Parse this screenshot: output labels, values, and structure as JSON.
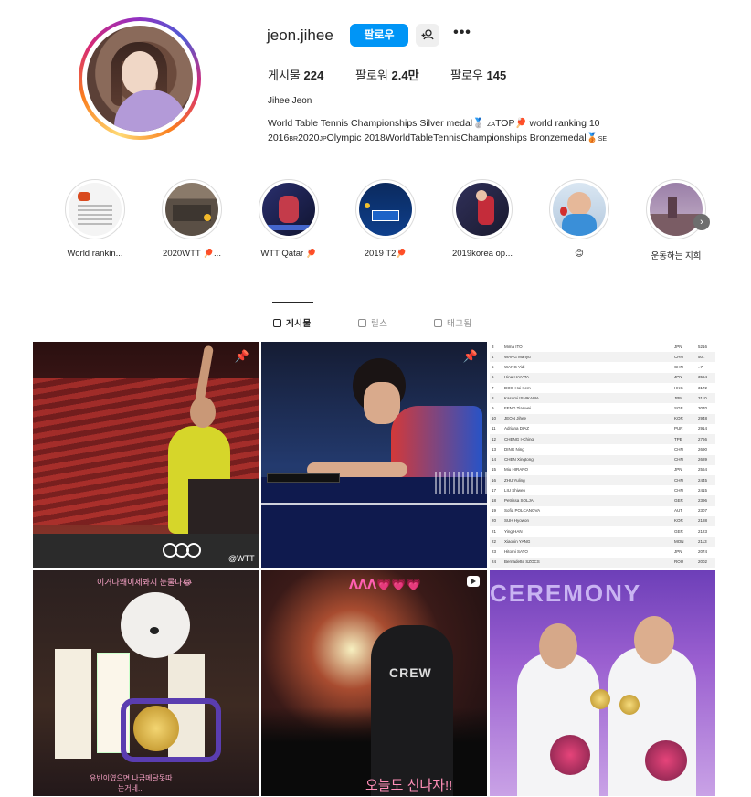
{
  "profile": {
    "username": "jeon.jihee",
    "follow_label": "팔로우",
    "more_label": "•••",
    "posts_label": "게시물",
    "posts_count": "224",
    "followers_label": "팔로워",
    "followers_count": "2.4만",
    "following_label": "팔로우",
    "following_count": "145",
    "full_name": "Jihee Jeon",
    "bio_line1_a": "World Table Tennis Championships Silver medal",
    "bio_line1_flag": "ZA",
    "bio_line1_b": "TOP",
    "bio_line1_c": " world ranking 10",
    "bio_line2_a": "2016",
    "bio_line2_flag1": "BR",
    "bio_line2_b": "2020",
    "bio_line2_flag2": "JP",
    "bio_line2_c": "Olympic 2018WorldTableTennisChampionships Bronzemedal",
    "bio_line2_flag3": "SE"
  },
  "highlights": [
    {
      "label": "World rankin..."
    },
    {
      "label": "2020WTT 🏓..."
    },
    {
      "label": "WTT Qatar 🏓"
    },
    {
      "label": "2019 T2🏓"
    },
    {
      "label": "2019korea op..."
    },
    {
      "label": "😊"
    },
    {
      "label": "운동하는 지희"
    }
  ],
  "tabs": [
    {
      "label": "게시물",
      "active": true
    },
    {
      "label": "릴스",
      "active": false
    },
    {
      "label": "태그됨",
      "active": false
    }
  ],
  "posts": {
    "p1_watermark": "@WTT",
    "p5_banner": "ᐱᐱᐱ💗💗💗",
    "p5_jacket": "CREW",
    "p5_caption": "오늘도 신나자!!",
    "p4_top": "이거나왜이제봐지 눈물나😂",
    "p4_bottom": "유빈이였으면 나금메달못따\n는거네...",
    "p6_banner": "CEREMONY"
  },
  "ranking": [
    [
      "3",
      "Mima ITO",
      "JPN",
      "5216"
    ],
    [
      "4",
      "WANG Manyu",
      "CHN",
      "50.."
    ],
    [
      "5",
      "WANG Yidi",
      "CHN",
      "..7"
    ],
    [
      "6",
      "Hina HAYATA",
      "JPN",
      "3564"
    ],
    [
      "7",
      "DOO Hoi Kem",
      "HKG",
      "3172"
    ],
    [
      "8",
      "Kasumi ISHIKAWA",
      "JPN",
      "3110"
    ],
    [
      "9",
      "FENG Tianwei",
      "SGP",
      "3070"
    ],
    [
      "10",
      "JEON Jihee",
      "KOR",
      "2948"
    ],
    [
      "11",
      "Adriana DIAZ",
      "PUR",
      "2914"
    ],
    [
      "12",
      "CHENG I-Ching",
      "TPE",
      "2766"
    ],
    [
      "13",
      "DING Ning",
      "CHN",
      "2690"
    ],
    [
      "14",
      "CHEN Xingtong",
      "CHN",
      "2689"
    ],
    [
      "15",
      "Miu HIRANO",
      "JPN",
      "2564"
    ],
    [
      "16",
      "ZHU Yuling",
      "CHN",
      "2445"
    ],
    [
      "17",
      "LIU Shiwen",
      "CHN",
      "2415"
    ],
    [
      "18",
      "Petrissa SOLJA",
      "GER",
      "2396"
    ],
    [
      "19",
      "Sofia POLCANOVA",
      "AUT",
      "2307"
    ],
    [
      "20",
      "SUH Hyowon",
      "KOR",
      "2188"
    ],
    [
      "21",
      "Ying HAN",
      "GER",
      "2123"
    ],
    [
      "22",
      "Xiaoxin YANG",
      "MON",
      "2113"
    ],
    [
      "23",
      "Hitomi SATO",
      "JPN",
      "2074"
    ],
    [
      "24",
      "Bernadette SZOCS",
      "ROU",
      "2002"
    ]
  ]
}
